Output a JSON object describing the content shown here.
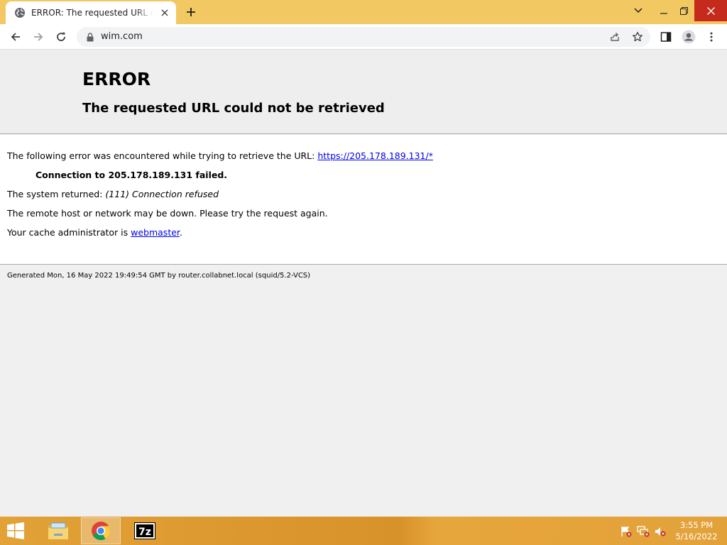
{
  "browser": {
    "tab": {
      "title": "ERROR: The requested URL could not be retrieved"
    },
    "address_bar": {
      "url": "wim.com"
    }
  },
  "page": {
    "heading": "ERROR",
    "subheading": "The requested URL could not be retrieved",
    "intro_text": "The following error was encountered while trying to retrieve the URL: ",
    "url_link": "https://205.178.189.131/*",
    "connection_failed": "Connection to 205.178.189.131 failed.",
    "system_returned_label": "The system returned: ",
    "system_returned_value": "(111) Connection refused",
    "remote_host_text": "The remote host or network may be down. Please try the request again.",
    "cache_admin_label": "Your cache administrator is ",
    "cache_admin_link": "webmaster",
    "cache_admin_suffix": ".",
    "footer": "Generated Mon, 16 May 2022 19:49:54 GMT by router.collabnet.local (squid/5.2-VCS)"
  },
  "taskbar": {
    "apps": [
      "file-explorer",
      "chrome",
      "7-zip"
    ],
    "active_app": "chrome",
    "seven_zip_label": "7z",
    "clock_time": "3:55 PM",
    "clock_date": "5/16/2022"
  },
  "colors": {
    "titlebar": "#f2c862",
    "close_button": "#c42b1c",
    "link": "#0000ee",
    "taskbar": "#e2a237"
  }
}
